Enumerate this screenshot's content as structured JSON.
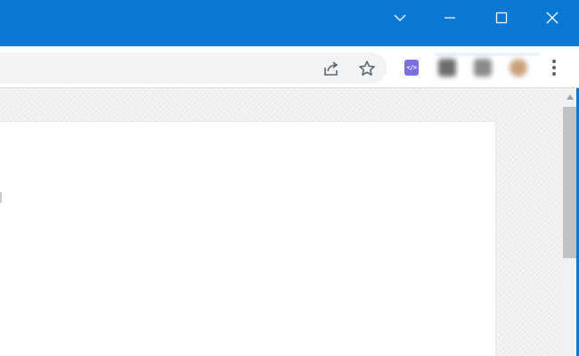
{
  "window": {
    "controls": {
      "tab_search_icon": "chevron-down-icon",
      "minimize_icon": "minimize-icon",
      "maximize_icon": "maximize-icon",
      "close_icon": "close-icon"
    },
    "title_bar_color": "#0b78d4"
  },
  "toolbar": {
    "address_bar_value": "",
    "share_icon": "share-icon",
    "bookmark_icon": "star-icon",
    "extensions": [
      {
        "icon": "code-extension-icon",
        "label": "</>",
        "color": "#7b6fe0"
      },
      {
        "icon": "blurred-extension-icon",
        "color": "#6d6d6d"
      },
      {
        "icon": "blurred-extension-icon",
        "color": "#8a8a8a"
      },
      {
        "icon": "profile-avatar-icon",
        "color": "#c9a27a"
      }
    ],
    "menu_icon": "more-vertical-icon"
  },
  "content": {
    "page_text": ""
  },
  "scrollbar": {
    "up_arrow_icon": "scroll-up-arrow-icon"
  }
}
